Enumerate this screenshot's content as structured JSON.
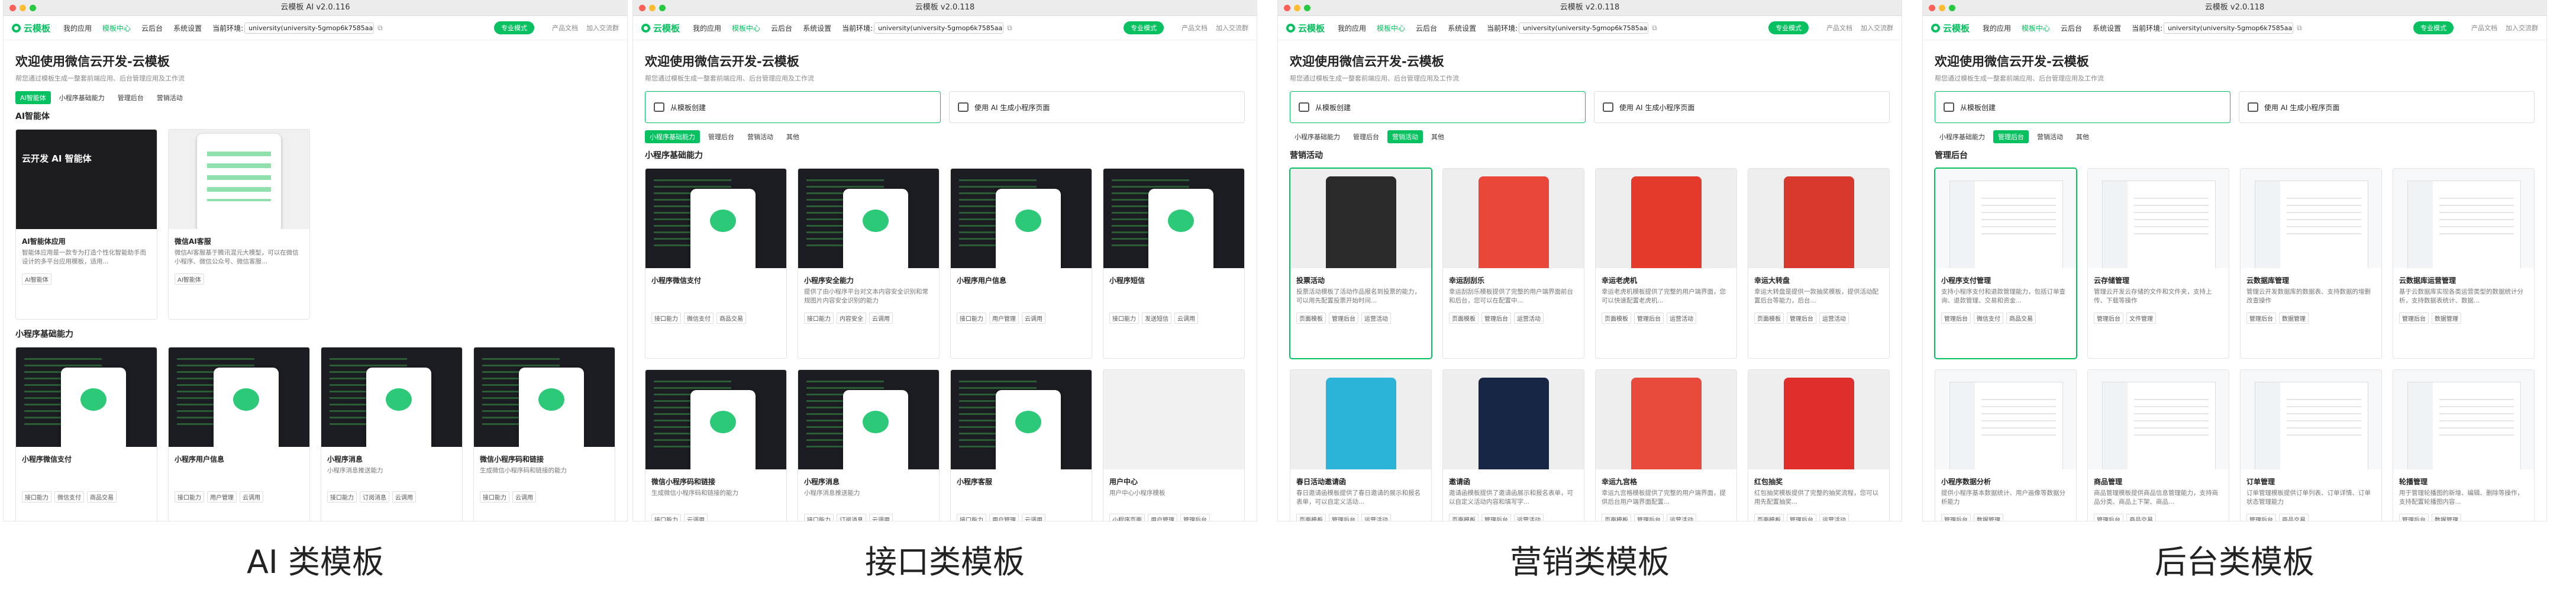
{
  "windows": [
    {
      "title": "云模板 AI v2.0.116",
      "nav": {
        "logo": "云模板",
        "items": [
          "我的应用",
          "模板中心",
          "云后台",
          "系统设置"
        ],
        "active_index": 1,
        "env_label": "当前环境:",
        "env_value": "university(university-5gmop6k7585aa3)",
        "copy_icon": "copy-icon",
        "switch_label": "专业模式",
        "doc_link": "产品文档",
        "community_link": "加入交流群"
      },
      "heading": "欢迎使用微信云开发-云模板",
      "subheading": "帮您通过模板生成一整套前端应用、后台管理应用及工作流",
      "entries": [],
      "tabs": [
        "AI智能体",
        "小程序基础能力",
        "管理后台",
        "营销活动"
      ],
      "active_tab": 0,
      "section1": "AI智能体",
      "cards": [
        {
          "kind": "ai-dark",
          "art": "云开发 AI 智能体",
          "title": "AI智能体应用",
          "desc": "智能体应用是一款专为打造个性化智能助手而设计的多平台应用模板，适用...",
          "tags": [
            "AI智能体"
          ]
        },
        {
          "kind": "ai-phone",
          "art": "",
          "title": "微信AI客服",
          "desc": "微信AI客服基于腾讯混元大模型，可以在微信小程序、微信公众号、微信客服...",
          "tags": [
            "AI智能体"
          ]
        }
      ],
      "section2": "小程序基础能力",
      "cards2": [
        {
          "kind": "code",
          "title": "小程序微信支付",
          "desc": "",
          "tags": [
            "接口能力",
            "微信支付",
            "商品交易"
          ]
        },
        {
          "kind": "code",
          "title": "小程序用户信息",
          "desc": "",
          "tags": [
            "接口能力",
            "用户管理",
            "云调用"
          ]
        },
        {
          "kind": "code",
          "title": "小程序消息",
          "desc": "小程序消息推送能力",
          "tags": [
            "接口能力",
            "订阅消息",
            "云调用"
          ]
        },
        {
          "kind": "code",
          "title": "微信小程序码和链接",
          "desc": "生成微信小程序码和链接的能力",
          "tags": [
            "接口能力",
            "云调用"
          ]
        }
      ],
      "caption": "AI 类模板"
    },
    {
      "title": "云模板 v2.0.118",
      "nav": {
        "logo": "云模板",
        "items": [
          "我的应用",
          "模板中心",
          "云后台",
          "系统设置"
        ],
        "active_index": 1,
        "env_label": "当前环境:",
        "env_value": "university(university-5gmop6k7585aa32)",
        "copy_icon": "copy-icon",
        "switch_label": "专业模式",
        "doc_link": "产品文档",
        "community_link": "加入交流群"
      },
      "heading": "欢迎使用微信云开发-云模板",
      "subheading": "帮您通过模板生成一整套前端应用、后台管理应用及工作流",
      "entries": [
        "从模板创建",
        "使用 AI 生成小程序页面"
      ],
      "tabs": [
        "小程序基础能力",
        "管理后台",
        "营销活动",
        "其他"
      ],
      "active_tab": 0,
      "section1": "小程序基础能力",
      "cards": [
        {
          "kind": "code",
          "title": "小程序微信支付",
          "desc": "",
          "tags": [
            "接口能力",
            "微信支付",
            "商品交易"
          ]
        },
        {
          "kind": "code",
          "title": "小程序安全能力",
          "desc": "提供了由小程序平台对文本内容安全识别和常规图片内容安全识别的能力",
          "tags": [
            "接口能力",
            "内容安全",
            "云调用"
          ]
        },
        {
          "kind": "code",
          "title": "小程序用户信息",
          "desc": "",
          "tags": [
            "接口能力",
            "用户管理",
            "云调用"
          ]
        },
        {
          "kind": "code",
          "title": "小程序短信",
          "desc": "",
          "tags": [
            "接口能力",
            "发送短信",
            "云调用"
          ]
        },
        {
          "kind": "code",
          "title": "微信小程序码和链接",
          "desc": "生成微信小程序码和链接的能力",
          "tags": [
            "接口能力",
            "云调用"
          ]
        },
        {
          "kind": "code",
          "title": "小程序消息",
          "desc": "小程序消息推送能力",
          "tags": [
            "接口能力",
            "订阅消息",
            "云调用"
          ]
        },
        {
          "kind": "code",
          "title": "小程序客服",
          "desc": "",
          "tags": [
            "接口能力",
            "用户管理",
            "云调用"
          ]
        },
        {
          "kind": "plain",
          "title": "用户中心",
          "desc": "用户中心小程序模板",
          "tags": [
            "小程序页面",
            "用户管理",
            "管理后台"
          ]
        }
      ],
      "caption": "接口类模板"
    },
    {
      "title": "云模板 v2.0.118",
      "nav": {
        "logo": "云模板",
        "items": [
          "我的应用",
          "模板中心",
          "云后台",
          "系统设置"
        ],
        "active_index": 1,
        "env_label": "当前环境:",
        "env_value": "university(university-5gmop6k7585aa32)",
        "copy_icon": "copy-icon",
        "switch_label": "专业模式",
        "doc_link": "产品文档",
        "community_link": "加入交流群"
      },
      "heading": "欢迎使用微信云开发-云模板",
      "subheading": "帮您通过模板生成一整套前端应用、后台管理应用及工作流",
      "entries": [
        "从模板创建",
        "使用 AI 生成小程序页面"
      ],
      "tabs": [
        "小程序基础能力",
        "管理后台",
        "营销活动",
        "其他"
      ],
      "active_tab": 2,
      "section1": "营销活动",
      "cards": [
        {
          "kind": "poster",
          "color": "#2a2a2a",
          "title": "投票活动",
          "desc": "投票活动模板了活动作品报名到投票的能力，可以用先配置投票开始时间...",
          "tags": [
            "页面模板",
            "管理后台",
            "运营活动"
          ]
        },
        {
          "kind": "poster",
          "color": "#e8473a",
          "title": "幸运刮刮乐",
          "desc": "幸运刮刮乐模板提供了完整的用户端界面前台和后台，您可以在配置中...",
          "tags": [
            "页面模板",
            "管理后台",
            "运营活动"
          ]
        },
        {
          "kind": "poster",
          "color": "#e33a2c",
          "title": "幸运老虎机",
          "desc": "幸运老虎机模板提供了完整的用户端界面，您可以快速配置老虎机...",
          "tags": [
            "页面模板",
            "管理后台",
            "运营活动"
          ]
        },
        {
          "kind": "poster",
          "color": "#d9382c",
          "title": "幸运大转盘",
          "desc": "幸运大转盘是提供一款抽奖模板，提供活动配置后台等能力，后台...",
          "tags": [
            "页面模板",
            "管理后台",
            "运营活动"
          ]
        },
        {
          "kind": "poster",
          "color": "#2bb4d8",
          "title": "春日活动邀请函",
          "desc": "春日邀请函模板提供了春日邀请的展示和报名表单，可以自定义活动...",
          "tags": [
            "页面模板",
            "管理后台",
            "运营活动"
          ]
        },
        {
          "kind": "poster",
          "color": "#162644",
          "title": "邀请函",
          "desc": "邀请函模板提供了邀请函展示和报名表单，可以自定义活动内容和填写字...",
          "tags": [
            "页面模板",
            "管理后台",
            "运营活动"
          ]
        },
        {
          "kind": "poster",
          "color": "#e84a3c",
          "title": "幸运九宫格",
          "desc": "幸运九宫格模板提供了完整的用户端界面，提供后台用户端界面配置...",
          "tags": [
            "页面模板",
            "管理后台",
            "运营活动"
          ]
        },
        {
          "kind": "poster",
          "color": "#e02f2a",
          "title": "红包抽奖",
          "desc": "红包抽奖模板提供了完整的抽奖流程，您可以用先配置抽奖...",
          "tags": [
            "页面模板",
            "管理后台",
            "运营活动"
          ]
        }
      ],
      "caption": "营销类模板"
    },
    {
      "title": "云模板 v2.0.118",
      "nav": {
        "logo": "云模板",
        "items": [
          "我的应用",
          "模板中心",
          "云后台",
          "系统设置"
        ],
        "active_index": 1,
        "env_label": "当前环境:",
        "env_value": "university(university-5gmop6k7585aa32)",
        "copy_icon": "copy-icon",
        "switch_label": "专业模式",
        "doc_link": "产品文档",
        "community_link": "加入交流群"
      },
      "heading": "欢迎使用微信云开发-云模板",
      "subheading": "帮您通过模板生成一整套前端应用、后台管理应用及工作流",
      "entries": [
        "从模板创建",
        "使用 AI 生成小程序页面"
      ],
      "tabs": [
        "小程序基础能力",
        "管理后台",
        "营销活动",
        "其他"
      ],
      "active_tab": 1,
      "section1": "管理后台",
      "cards": [
        {
          "kind": "admin",
          "title": "小程序支付管理",
          "desc": "支持小程序支付和退款管理能力，包括订单查询、退款管理、交易和资金...",
          "tags": [
            "管理后台",
            "微信支付",
            "商品交易"
          ]
        },
        {
          "kind": "admin",
          "title": "云存储管理",
          "desc": "管理云开发云存储的文件和文件夹，支持上传、下载等操作",
          "tags": [
            "管理后台",
            "文件管理"
          ]
        },
        {
          "kind": "admin",
          "title": "云数据库管理",
          "desc": "管理云开发数据库的数据表、支持数据的增删改查操作",
          "tags": [
            "管理后台",
            "数据管理"
          ]
        },
        {
          "kind": "admin",
          "title": "云数据库运营管理",
          "desc": "基于云数据库实现各类运营类型的数据统计分析，支持数据表统计、数据...",
          "tags": [
            "管理后台",
            "数据管理"
          ]
        },
        {
          "kind": "admin",
          "title": "小程序数据分析",
          "desc": "提供小程序基本数据统计、用户画像等数据分析能力",
          "tags": [
            "管理后台",
            "数据管理"
          ]
        },
        {
          "kind": "admin",
          "title": "商品管理",
          "desc": "商品管理模板提供商品信息管理能力，支持商品分类、商品上下架、商品...",
          "tags": [
            "管理后台",
            "商品交易"
          ]
        },
        {
          "kind": "admin",
          "title": "订单管理",
          "desc": "订单管理模板提供订单列表、订单详情、订单状态管理能力",
          "tags": [
            "管理后台",
            "商品交易"
          ]
        },
        {
          "kind": "admin",
          "title": "轮播管理",
          "desc": "用于管理轮播图的新增、编辑、删除等操作，支持配置轮播图内容...",
          "tags": [
            "管理后台",
            "数据管理"
          ]
        }
      ],
      "caption": "后台类模板"
    }
  ],
  "colors": {
    "brand": "#07c160",
    "border": "#e3e3e3",
    "muted": "#888888"
  }
}
